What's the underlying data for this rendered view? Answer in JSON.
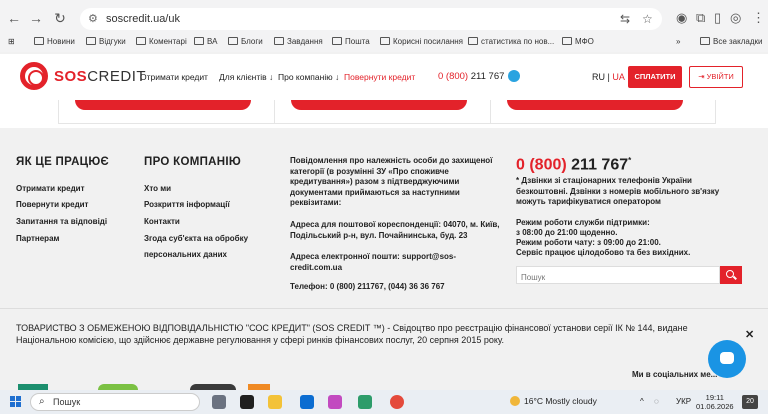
{
  "browser": {
    "url": "soscredit.ua/uk",
    "bookmarks": [
      "Новини",
      "Відгуки",
      "Коментарі",
      "ВА",
      "Блоги",
      "Завдання",
      "Пошта",
      "Корисні посилання",
      "статистика по нов...",
      "МФО"
    ],
    "all_bookmarks": "Все закладки"
  },
  "header": {
    "logo_main": "SOS",
    "logo_sub": "CREDIT",
    "nav": [
      "Отримати кредит",
      "Для клієнтів ↓",
      "Про компанію ↓"
    ],
    "repay": "Повернути кредит",
    "phone_prefix": "0 (800)",
    "phone_number": "211 767",
    "lang_ru": "RU",
    "lang_sep": "|",
    "lang_ua": "UA",
    "pay_label": "СПЛАТИТИ",
    "login_label": "УВІЙТИ"
  },
  "footer": {
    "how_title": "ЯК ЦЕ ПРАЦЮЄ",
    "how_links": [
      "Отримати кредит",
      "Повернути кредит",
      "Запитання та відповіді",
      "Партнерам"
    ],
    "about_title": "ПРО КОМПАНІЮ",
    "about_links": [
      "Хто ми",
      "Розкриття інформації",
      "Контакти",
      "Згода суб'єкта на обробку",
      "персональних даних"
    ],
    "notice": "Повідомлення про належність особи до захищеної категорії (в розумінні ЗУ «Про споживче кредитування») разом з підтверджуючими документами приймаються за наступними реквізитами:",
    "address": "Адреса для поштової кореспонденції: 04070, м. Київ, Подільський р-н, вул. Почайнинська, буд. 23",
    "email": "Адреса електронної пошти: support@sos-credit.com.ua",
    "phones": "Телефон: 0 (800) 211767, (044) 36 36 767",
    "hotline_prefix": "0 (800)",
    "hotline_number": "211 767",
    "hotline_star": "*",
    "hotline_note": "* Дзвінки зі стаціонарних телефонів України безкоштовні. Дзвінки з номерів мобільного зв'язку можуть тарифікуватися оператором",
    "schedule_1": "Режим роботи служби підтримки:",
    "schedule_2": "з 08:00 до 21:00 щоденно.",
    "schedule_3": "Режим роботи чату: з 09:00 до 21:00.",
    "schedule_4": "Сервіс працює цілодобово та без вихідних.",
    "search_placeholder": "Пошук",
    "legal": "ТОВАРИСТВО З ОБМЕЖЕНОЮ ВІДПОВІДАЛЬНІСТЮ \"СОС КРЕДИТ\" (SOS CREDIT ™) - Свідоцтво про реєстрацію фінансової установи серії ІК № 144, видане Національною комісією, що здійснює державне регулювання у сфері ринків фінансових послуг, 20 серпня 2015 року.",
    "close": "✕",
    "social_label": "Ми в соціальних ме..."
  },
  "taskbar": {
    "search": "Пошук",
    "weather": "16°C  Mostly cloudy",
    "lang": "УКР",
    "time": "19:11",
    "date": "01.06.2026",
    "notifications": "20"
  },
  "colors": {
    "brand_red": "#e3222a",
    "chat_blue": "#1a94e4"
  }
}
